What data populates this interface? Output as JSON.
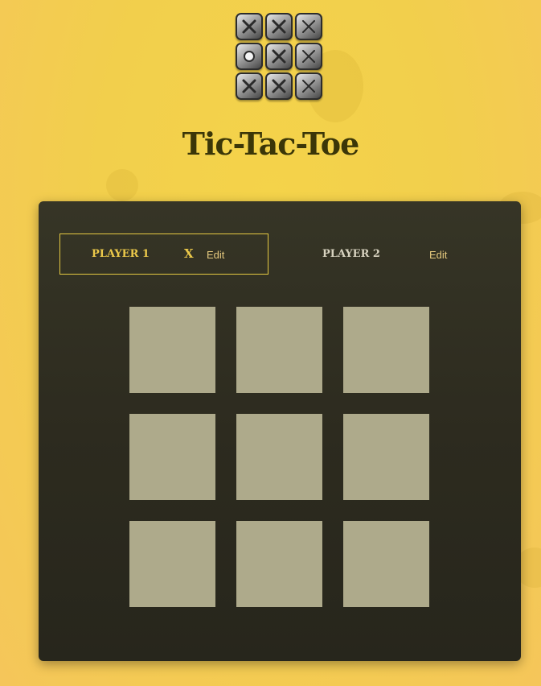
{
  "game": {
    "title": "Tic-Tac-Toe"
  },
  "logo": {
    "tiles": [
      "x-icon",
      "x-icon",
      "x-icon",
      "o-icon",
      "x-icon",
      "x-icon",
      "x-icon",
      "x-icon",
      "x-icon"
    ]
  },
  "players": [
    {
      "name": "PLAYER 1",
      "symbol": "X",
      "edit_label": "Edit",
      "active": true
    },
    {
      "name": "PLAYER 2",
      "symbol": "",
      "edit_label": "Edit",
      "active": false
    }
  ],
  "board": {
    "cells": [
      "",
      "",
      "",
      "",
      "",
      "",
      "",
      "",
      ""
    ]
  },
  "colors": {
    "background": "#f2cf4c",
    "panel": "#2d2b1f",
    "cell": "#aeaa8b",
    "accent": "#ecc94a",
    "title": "#3b3608"
  }
}
